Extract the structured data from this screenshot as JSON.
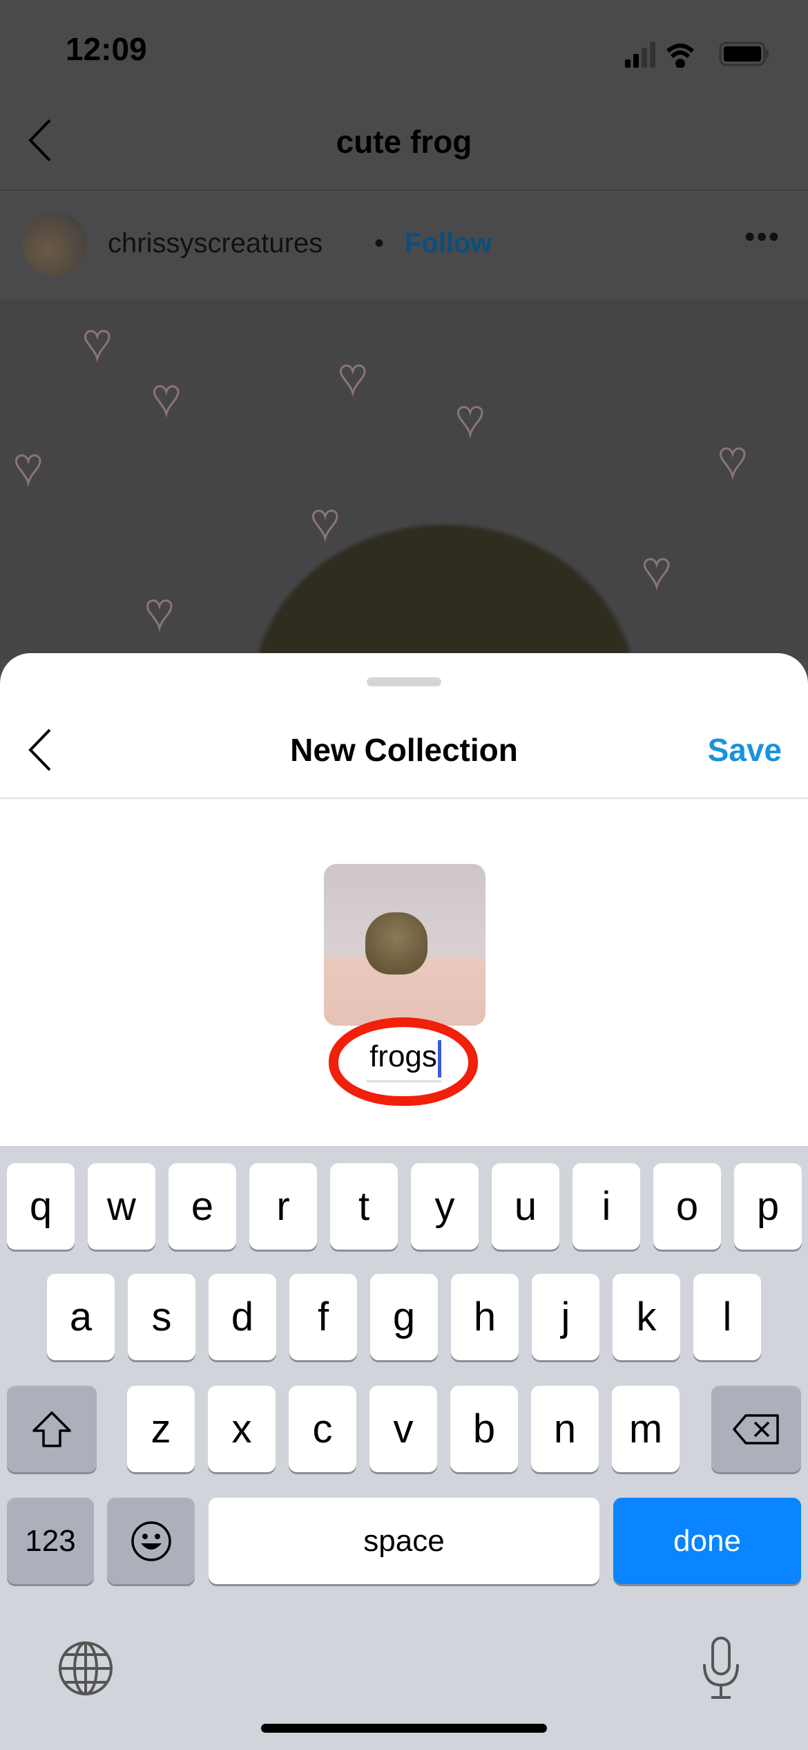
{
  "status_bar": {
    "time": "12:09",
    "signal_icon": "cellular-signal-icon",
    "wifi_icon": "wifi-icon",
    "battery_icon": "battery-icon"
  },
  "background_page": {
    "title": "cute frog",
    "username": "chrissyscreatures",
    "separator": "•",
    "follow_label": "Follow",
    "follow_color": "#0a4f7e"
  },
  "sheet": {
    "title": "New Collection",
    "save_label": "Save",
    "save_color": "#1a92dc",
    "collection_name": "frogs",
    "annotation_color": "#f0200a"
  },
  "keyboard": {
    "row1": [
      "q",
      "w",
      "e",
      "r",
      "t",
      "y",
      "u",
      "i",
      "o",
      "p"
    ],
    "row2": [
      "a",
      "s",
      "d",
      "f",
      "g",
      "h",
      "j",
      "k",
      "l"
    ],
    "row3": [
      "z",
      "x",
      "c",
      "v",
      "b",
      "n",
      "m"
    ],
    "numbers_label": "123",
    "space_label": "space",
    "done_label": "done",
    "done_color": "#0a84ff"
  }
}
